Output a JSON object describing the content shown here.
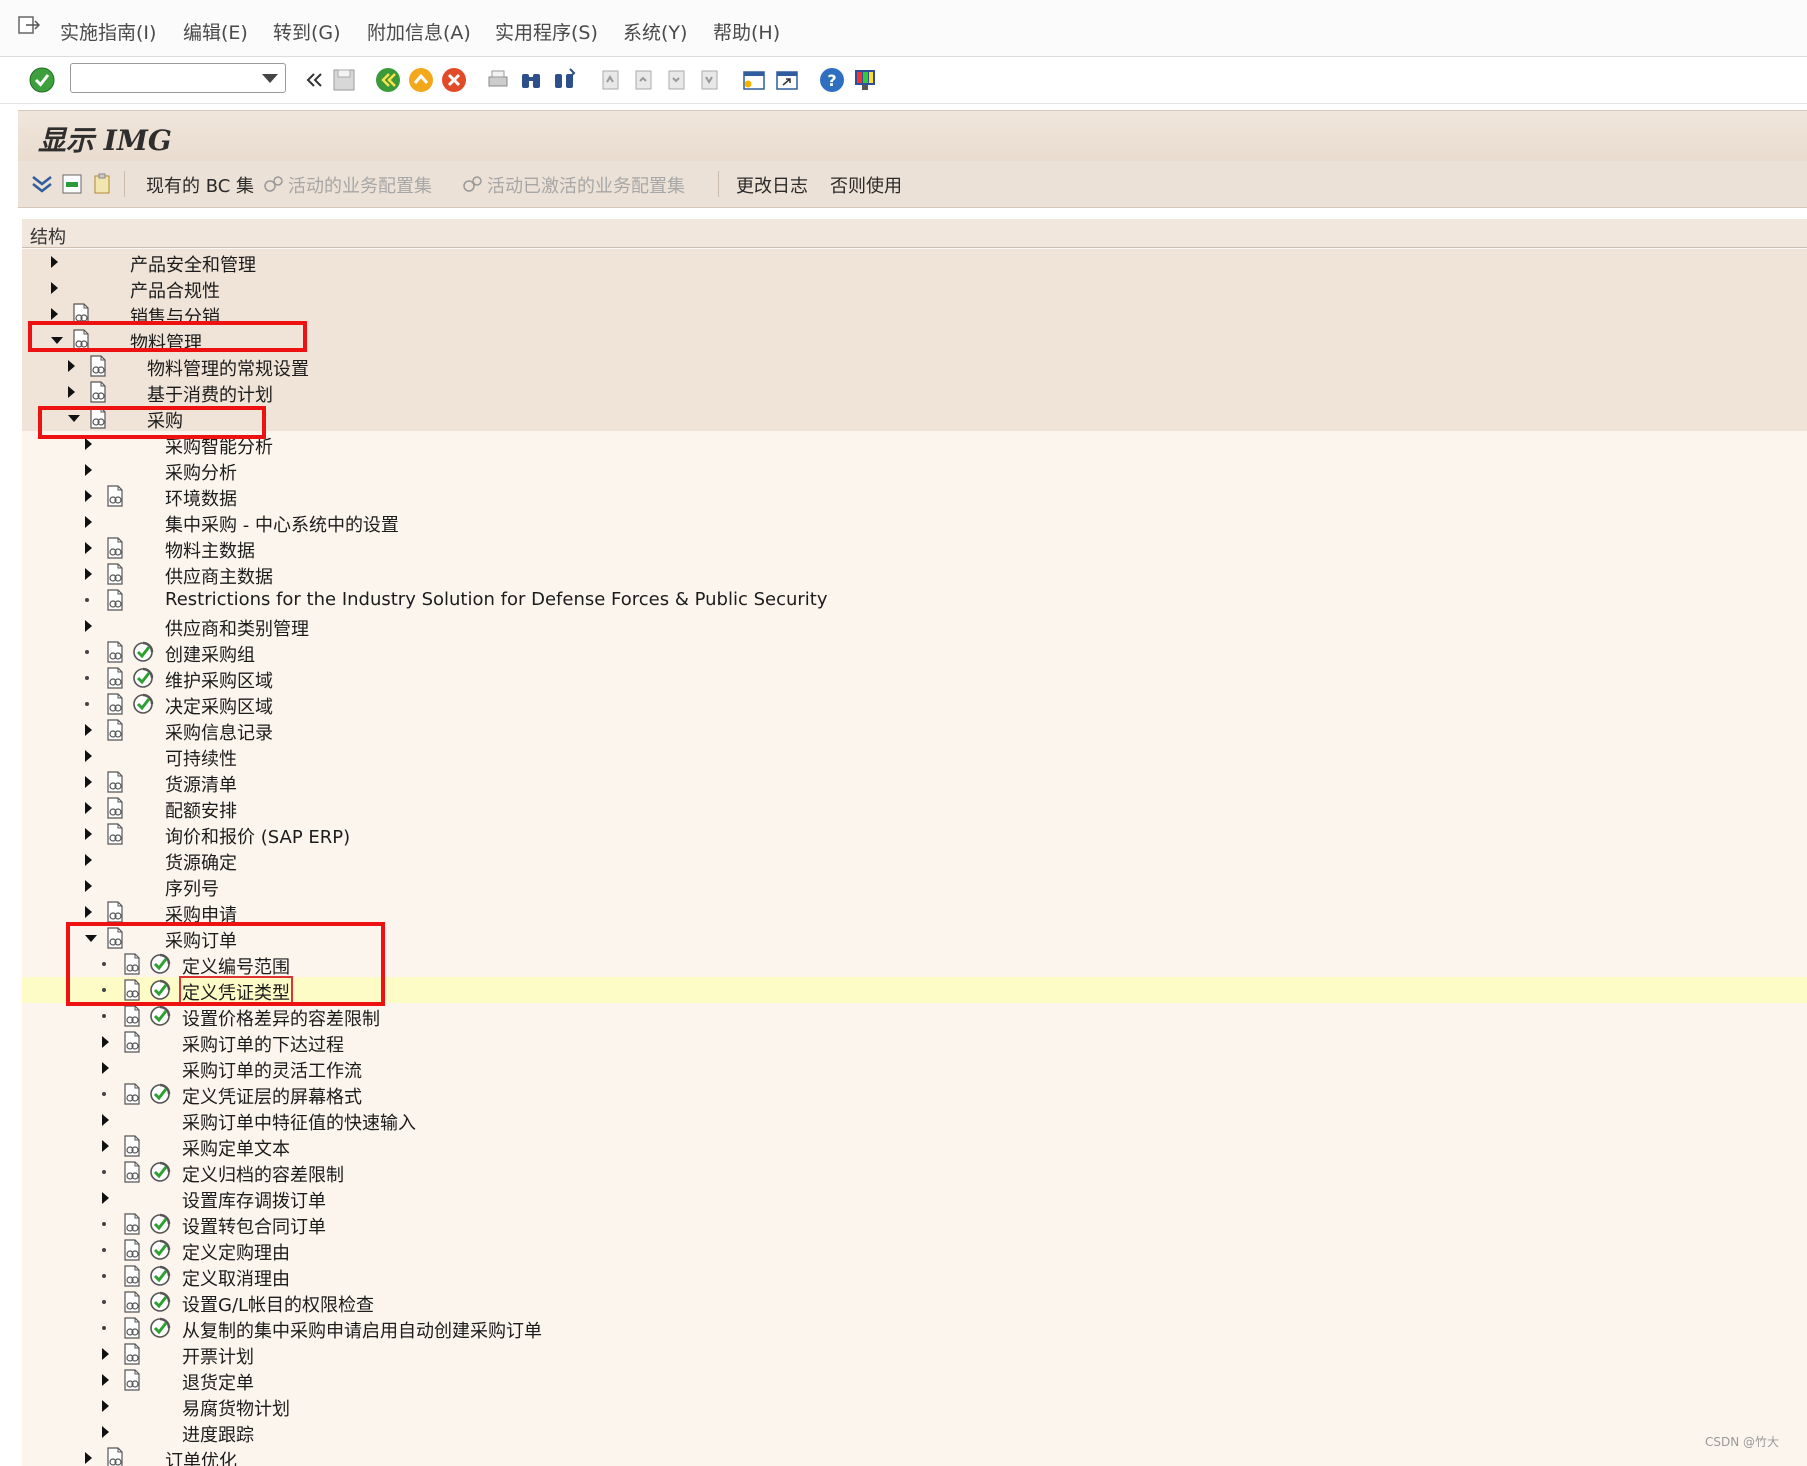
{
  "menu": {
    "items": [
      "实施指南(I)",
      "编辑(E)",
      "转到(G)",
      "附加信息(A)",
      "实用程序(S)",
      "系统(Y)",
      "帮助(H)"
    ]
  },
  "toolbar": {
    "command_value": ""
  },
  "title": "显示 IMG",
  "app_toolbar": {
    "bc_sets": "现有的 BC 集",
    "active_config_sets": "活动的业务配置集",
    "activated_config_sets": "活动已激活的业务配置集",
    "change_log": "更改日志",
    "otherwise_use": "否则使用"
  },
  "tree": {
    "header": "结构",
    "rows": [
      {
        "label": "产品安全和管理",
        "level": 0,
        "state": "closed",
        "doc": false,
        "act": false
      },
      {
        "label": "产品合规性",
        "level": 0,
        "state": "closed",
        "doc": false,
        "act": false
      },
      {
        "label": "销售与分销",
        "level": 0,
        "state": "closed",
        "doc": true,
        "act": false
      },
      {
        "label": "物料管理",
        "level": 0,
        "state": "open",
        "doc": true,
        "act": false
      },
      {
        "label": "物料管理的常规设置",
        "level": 1,
        "state": "closed",
        "doc": true,
        "act": false
      },
      {
        "label": "基于消费的计划",
        "level": 1,
        "state": "closed",
        "doc": true,
        "act": false
      },
      {
        "label": "采购",
        "level": 1,
        "state": "open",
        "doc": true,
        "act": false
      },
      {
        "label": "采购智能分析",
        "level": 2,
        "state": "closed",
        "doc": false,
        "act": false
      },
      {
        "label": "采购分析",
        "level": 2,
        "state": "closed",
        "doc": false,
        "act": false
      },
      {
        "label": "环境数据",
        "level": 2,
        "state": "closed",
        "doc": true,
        "act": false
      },
      {
        "label": "集中采购 - 中心系统中的设置",
        "level": 2,
        "state": "closed",
        "doc": false,
        "act": false
      },
      {
        "label": "物料主数据",
        "level": 2,
        "state": "closed",
        "doc": true,
        "act": false
      },
      {
        "label": "供应商主数据",
        "level": 2,
        "state": "closed",
        "doc": true,
        "act": false
      },
      {
        "label": "Restrictions for the Industry Solution for Defense Forces & Public Security",
        "level": 2,
        "state": "leaf",
        "doc": true,
        "act": false
      },
      {
        "label": "供应商和类别管理",
        "level": 2,
        "state": "closed",
        "doc": false,
        "act": false
      },
      {
        "label": "创建采购组",
        "level": 2,
        "state": "leaf",
        "doc": true,
        "act": true
      },
      {
        "label": "维护采购区域",
        "level": 2,
        "state": "leaf",
        "doc": true,
        "act": true
      },
      {
        "label": "决定采购区域",
        "level": 2,
        "state": "leaf",
        "doc": true,
        "act": true
      },
      {
        "label": "采购信息记录",
        "level": 2,
        "state": "closed",
        "doc": true,
        "act": false
      },
      {
        "label": "可持续性",
        "level": 2,
        "state": "closed",
        "doc": false,
        "act": false
      },
      {
        "label": "货源清单",
        "level": 2,
        "state": "closed",
        "doc": true,
        "act": false
      },
      {
        "label": "配额安排",
        "level": 2,
        "state": "closed",
        "doc": true,
        "act": false
      },
      {
        "label": "询价和报价 (SAP ERP)",
        "level": 2,
        "state": "closed",
        "doc": true,
        "act": false
      },
      {
        "label": "货源确定",
        "level": 2,
        "state": "closed",
        "doc": false,
        "act": false
      },
      {
        "label": "序列号",
        "level": 2,
        "state": "closed",
        "doc": false,
        "act": false
      },
      {
        "label": "采购申请",
        "level": 2,
        "state": "closed",
        "doc": true,
        "act": false
      },
      {
        "label": "采购订单",
        "level": 2,
        "state": "open",
        "doc": true,
        "act": false
      },
      {
        "label": "定义编号范围",
        "level": 3,
        "state": "leaf",
        "doc": true,
        "act": true
      },
      {
        "label": "定义凭证类型",
        "level": 3,
        "state": "leaf",
        "doc": true,
        "act": true,
        "selected": true
      },
      {
        "label": "设置价格差异的容差限制",
        "level": 3,
        "state": "leaf",
        "doc": true,
        "act": true
      },
      {
        "label": "采购订单的下达过程",
        "level": 3,
        "state": "closed",
        "doc": true,
        "act": false
      },
      {
        "label": "采购订单的灵活工作流",
        "level": 3,
        "state": "closed",
        "doc": false,
        "act": false
      },
      {
        "label": "定义凭证层的屏幕格式",
        "level": 3,
        "state": "leaf",
        "doc": true,
        "act": true
      },
      {
        "label": "采购订单中特征值的快速输入",
        "level": 3,
        "state": "closed",
        "doc": false,
        "act": false
      },
      {
        "label": "采购定单文本",
        "level": 3,
        "state": "closed",
        "doc": true,
        "act": false
      },
      {
        "label": "定义归档的容差限制",
        "level": 3,
        "state": "leaf",
        "doc": true,
        "act": true
      },
      {
        "label": "设置库存调拨订单",
        "level": 3,
        "state": "closed",
        "doc": false,
        "act": false
      },
      {
        "label": "设置转包合同订单",
        "level": 3,
        "state": "leaf",
        "doc": true,
        "act": true
      },
      {
        "label": "定义定购理由",
        "level": 3,
        "state": "leaf",
        "doc": true,
        "act": true
      },
      {
        "label": "定义取消理由",
        "level": 3,
        "state": "leaf",
        "doc": true,
        "act": true
      },
      {
        "label": "设置G/L帐目的权限检查",
        "level": 3,
        "state": "leaf",
        "doc": true,
        "act": true
      },
      {
        "label": "从复制的集中采购申请启用自动创建采购订单",
        "level": 3,
        "state": "leaf",
        "doc": true,
        "act": true
      },
      {
        "label": "开票计划",
        "level": 3,
        "state": "closed",
        "doc": true,
        "act": false
      },
      {
        "label": "退货定单",
        "level": 3,
        "state": "closed",
        "doc": true,
        "act": false
      },
      {
        "label": "易腐货物计划",
        "level": 3,
        "state": "closed",
        "doc": false,
        "act": false
      },
      {
        "label": "进度跟踪",
        "level": 3,
        "state": "closed",
        "doc": false,
        "act": false
      },
      {
        "label": "订单优化",
        "level": 2,
        "state": "closed",
        "doc": true,
        "act": false
      }
    ]
  },
  "watermark": "CSDN @竹大"
}
